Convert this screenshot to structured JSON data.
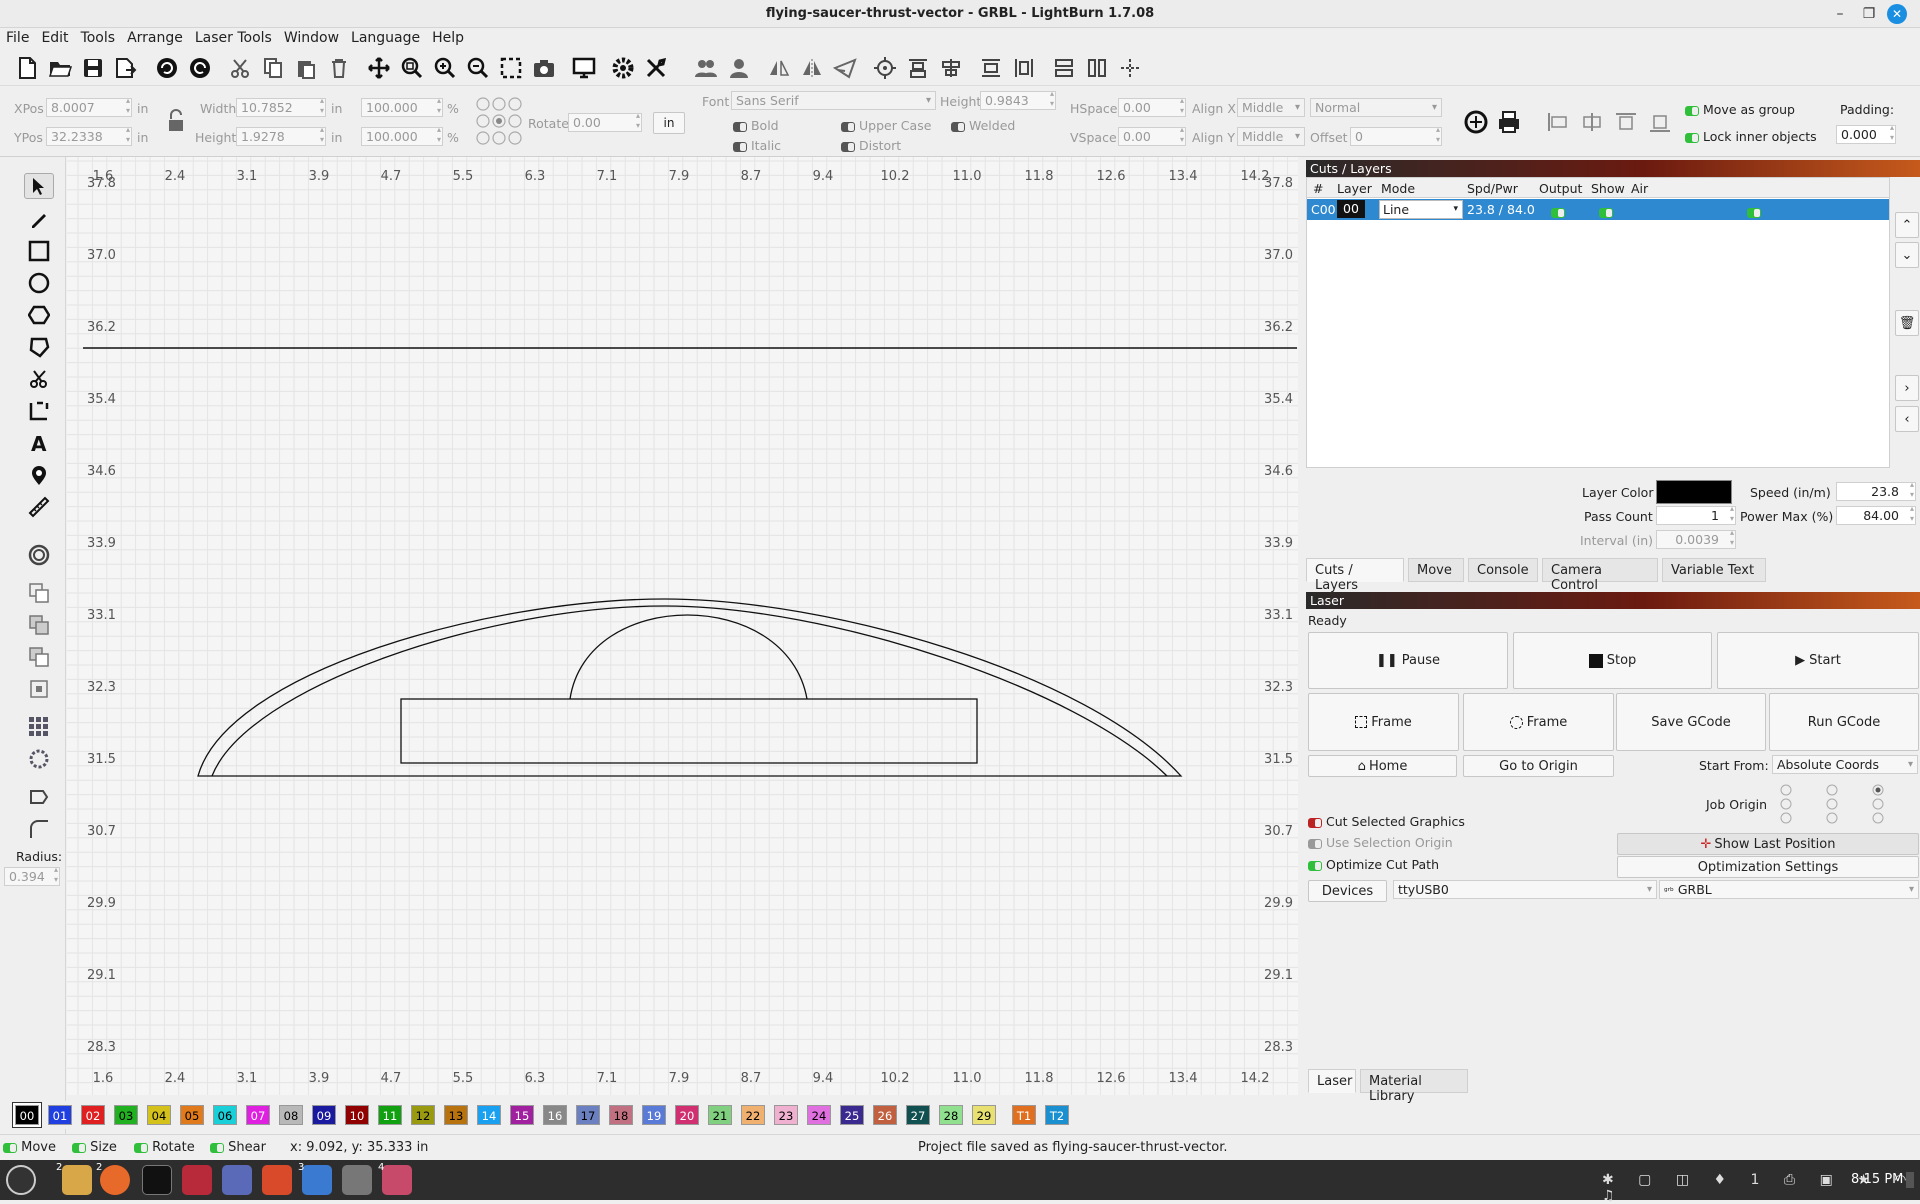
{
  "window": {
    "title": "flying-saucer-thrust-vector - GRBL - LightBurn 1.7.08"
  },
  "menu": [
    "File",
    "Edit",
    "Tools",
    "Arrange",
    "Laser Tools",
    "Window",
    "Language",
    "Help"
  ],
  "props": {
    "xpos_label": "XPos",
    "xpos": "8.0007",
    "ypos_label": "YPos",
    "ypos": "32.2338",
    "unit": "in",
    "width_label": "Width",
    "width": "10.7852",
    "height_label": "Height",
    "height": "1.9278",
    "scale_w": "100.000",
    "scale_h": "100.000",
    "pct": "%",
    "rotate_label": "Rotate",
    "rotate": "0.00",
    "in_btn": "in",
    "font_label": "Font",
    "font": "Sans Serif",
    "fheight_label": "Height",
    "fheight": "0.9843",
    "bold": "Bold",
    "italic": "Italic",
    "upper": "Upper Case",
    "distort": "Distort",
    "welded": "Welded",
    "hspace_label": "HSpace",
    "hspace": "0.00",
    "vspace_label": "VSpace",
    "vspace": "0.00",
    "alignx_label": "Align X",
    "alignx": "Middle",
    "aligny_label": "Align Y",
    "aligny": "Middle",
    "normal": "Normal",
    "offset_label": "Offset",
    "offset": "0",
    "move_group": "Move as group",
    "lock_inner": "Lock inner objects",
    "padding_label": "Padding:",
    "padding": "0.000"
  },
  "left": {
    "radius_label": "Radius:",
    "radius": "0.394"
  },
  "ruler": {
    "x_ticks": [
      "1.6",
      "2.4",
      "3.1",
      "3.9",
      "4.7",
      "5.5",
      "6.3",
      "7.1",
      "7.9",
      "8.7",
      "9.4",
      "10.2",
      "11.0",
      "11.8",
      "12.6",
      "13.4",
      "14.2"
    ],
    "y_ticks": [
      "37.8",
      "37.0",
      "36.2",
      "35.4",
      "34.6",
      "33.9",
      "33.1",
      "32.3",
      "31.5",
      "30.7",
      "29.9",
      "29.1",
      "28.3"
    ]
  },
  "cuts": {
    "title": "Cuts / Layers",
    "headers": [
      "#",
      "Layer",
      "Mode",
      "Spd/Pwr",
      "Output",
      "Show",
      "Air"
    ],
    "row": {
      "num": "C00",
      "layer": "00",
      "mode": "Line",
      "spdpwr": "23.8 / 84.0"
    },
    "layer_color_label": "Layer Color",
    "speed_label": "Speed (in/m)",
    "speed": "23.8",
    "pass_label": "Pass Count",
    "pass": "1",
    "power_label": "Power Max (%)",
    "power": "84.00",
    "interval_label": "Interval (in)",
    "interval": "0.0039",
    "tabs": [
      "Cuts / Layers",
      "Move",
      "Console",
      "Camera Control",
      "Variable Text"
    ]
  },
  "laser": {
    "title": "Laser",
    "status": "Ready",
    "pause": "Pause",
    "stop": "Stop",
    "start": "Start",
    "frame1": "Frame",
    "frame2": "Frame",
    "save_gcode": "Save GCode",
    "run_gcode": "Run GCode",
    "home": "Home",
    "go_origin": "Go to Origin",
    "start_from_label": "Start From:",
    "start_from": "Absolute Coords",
    "job_origin": "Job Origin",
    "cut_selected": "Cut Selected Graphics",
    "use_sel_origin": "Use Selection Origin",
    "optimize": "Optimize Cut Path",
    "show_last": "Show Last Position",
    "opt_settings": "Optimization Settings",
    "devices": "Devices",
    "port": "ttyUSB0",
    "device": "GRBL",
    "tabs": [
      "Laser",
      "Material Library"
    ]
  },
  "palette": [
    {
      "label": "00",
      "color": "#000000",
      "fg": "#ffffff"
    },
    {
      "label": "01",
      "color": "#1f3fe0",
      "fg": "#ffffff"
    },
    {
      "label": "02",
      "color": "#e02020",
      "fg": "#ffffff"
    },
    {
      "label": "03",
      "color": "#20b020",
      "fg": "#000000"
    },
    {
      "label": "04",
      "color": "#d4c21a",
      "fg": "#000000"
    },
    {
      "label": "05",
      "color": "#e07a1a",
      "fg": "#000000"
    },
    {
      "label": "06",
      "color": "#1ad0d8",
      "fg": "#000000"
    },
    {
      "label": "07",
      "color": "#e020e0",
      "fg": "#ffffff"
    },
    {
      "label": "08",
      "color": "#b8b8b8",
      "fg": "#000000"
    },
    {
      "label": "09",
      "color": "#1a1aa0",
      "fg": "#ffffff"
    },
    {
      "label": "10",
      "color": "#900000",
      "fg": "#ffffff"
    },
    {
      "label": "11",
      "color": "#10a010",
      "fg": "#ffffff"
    },
    {
      "label": "12",
      "color": "#9a9a10",
      "fg": "#000000"
    },
    {
      "label": "13",
      "color": "#b8720e",
      "fg": "#000000"
    },
    {
      "label": "14",
      "color": "#1aa0f0",
      "fg": "#ffffff"
    },
    {
      "label": "15",
      "color": "#a020a0",
      "fg": "#ffffff"
    },
    {
      "label": "16",
      "color": "#888888",
      "fg": "#ffffff"
    },
    {
      "label": "17",
      "color": "#6a80c0",
      "fg": "#000000"
    },
    {
      "label": "18",
      "color": "#c07080",
      "fg": "#000000"
    },
    {
      "label": "19",
      "color": "#5a7ad8",
      "fg": "#ffffff"
    },
    {
      "label": "20",
      "color": "#d03070",
      "fg": "#ffffff"
    },
    {
      "label": "21",
      "color": "#80d080",
      "fg": "#000000"
    },
    {
      "label": "22",
      "color": "#f0b070",
      "fg": "#000000"
    },
    {
      "label": "23",
      "color": "#f0b0d0",
      "fg": "#000000"
    },
    {
      "label": "24",
      "color": "#e070e0",
      "fg": "#000000"
    },
    {
      "label": "25",
      "color": "#3a2a90",
      "fg": "#ffffff"
    },
    {
      "label": "26",
      "color": "#c06040",
      "fg": "#ffffff"
    },
    {
      "label": "27",
      "color": "#105050",
      "fg": "#ffffff"
    },
    {
      "label": "28",
      "color": "#90e090",
      "fg": "#000000"
    },
    {
      "label": "29",
      "color": "#e8e070",
      "fg": "#000000"
    },
    {
      "label": "T1",
      "color": "#e07020",
      "fg": "#ffffff"
    },
    {
      "label": "T2",
      "color": "#1a90d0",
      "fg": "#ffffff"
    }
  ],
  "status": {
    "move": "Move",
    "size": "Size",
    "rotate": "Rotate",
    "shear": "Shear",
    "coords": "x: 9.092, y: 35.333 in",
    "message": "Project file saved as flying-saucer-thrust-vector."
  },
  "taskbar": {
    "time": "8:15 PM",
    "badge1": "2",
    "badge2": "2",
    "badge3": "3",
    "badge4": "4",
    "ws": "1"
  }
}
